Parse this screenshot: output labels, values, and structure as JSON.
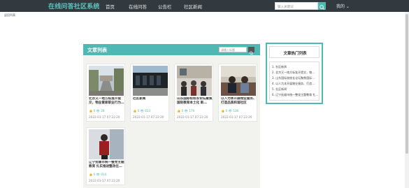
{
  "header": {
    "brand": "在线问答社区系统",
    "nav": [
      "首页",
      "在线问答",
      "公告栏",
      "社区新闻"
    ],
    "search_placeholder": "输入关键词",
    "mine": "我的 ⌄"
  },
  "back_link": "返回列表",
  "list": {
    "title": "文章列表",
    "search_placeholder": "请输入标题",
    "articles": [
      {
        "title": "北京又一地方标准开提交，物业管家职业行为…",
        "stats": "👍 0  👁 28",
        "date": "2022-01-17 07:22:20"
      },
      {
        "title": "社区新闻",
        "stats": "👍 0  👁 633",
        "date": "2022-01-17 07:22:20"
      },
      {
        "title": "山东国际校校长论坛聚焦国际教育本土化 新…",
        "stats": "👍 0  👁 179",
        "date": "2022-01-17 07:22:20"
      },
      {
        "title": "以人为本开展物业服务、打造品质和谐社区",
        "stats": "👍 0  👁 536",
        "date": "2022-01-17 07:22:20"
      },
      {
        "title": "辽宁抚顺市统一整党主题教育 扎实推进整改在…",
        "stats": "👍 0  👁 914",
        "date": "2022-01-17 07:22:20"
      }
    ]
  },
  "hot": {
    "title": "文章热门列表",
    "items": [
      "1. 社区新闻",
      "2. 北京又一地方标准开提交，物…",
      "3. 山东国际校校长论坛聚焦国际…",
      "4. 以人为本开展物业服务、打造…",
      "5. 社区新闻",
      "6. 辽宁抚顺市统一整党主题教育 扎…"
    ]
  },
  "colors": {
    "accent": "#4fb8b3",
    "topbar": "#333a3f"
  }
}
